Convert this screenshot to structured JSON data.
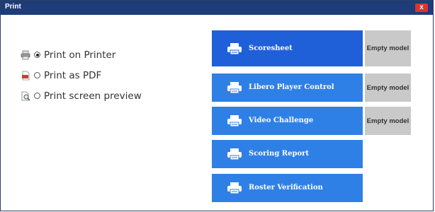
{
  "window": {
    "title": "Print",
    "close_label": "x"
  },
  "print_options": [
    {
      "label": "Print on Printer",
      "icon": "printer-icon",
      "selected": true
    },
    {
      "label": "Print as PDF",
      "icon": "pdf-icon",
      "selected": false
    },
    {
      "label": "Print screen preview",
      "icon": "preview-icon",
      "selected": false
    }
  ],
  "documents": [
    {
      "label": "Scoresheet",
      "model": "Empty model"
    },
    {
      "label": "Libero Player Control",
      "model": "Empty model"
    },
    {
      "label": "Video Challenge",
      "model": "Empty model"
    },
    {
      "label": "Scoring Report"
    },
    {
      "label": "Roster Verification"
    }
  ],
  "colors": {
    "titlebar": "#1d3c78",
    "primary_button": "#1f60d8",
    "button": "#2f80e6",
    "model_button": "#c9c9c9",
    "close": "#d9352c"
  }
}
